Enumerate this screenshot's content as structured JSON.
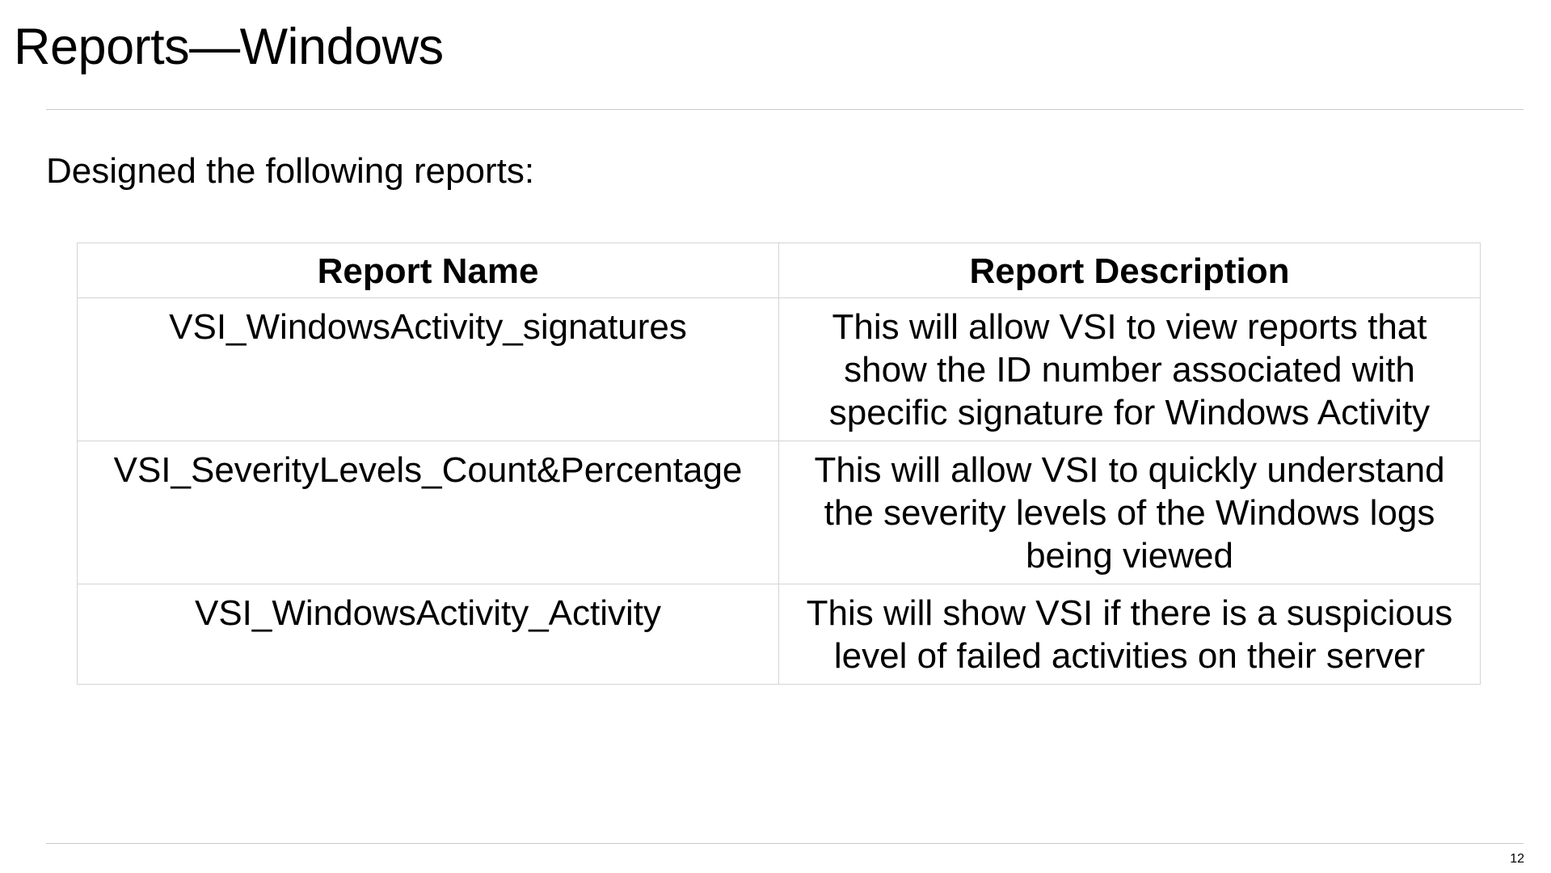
{
  "slide": {
    "title": "Reports—Windows",
    "intro": "Designed the following reports:",
    "page_number": "12"
  },
  "table": {
    "headers": [
      "Report Name",
      "Report Description"
    ],
    "rows": [
      {
        "name": "VSI_WindowsActivity_signatures",
        "description": "This will allow VSI to view reports that show the ID number associated with specific signature for Windows Activity"
      },
      {
        "name": "VSI_SeverityLevels_Count&Percentage",
        "description": "This will allow VSI to quickly understand the severity levels of the Windows logs being viewed"
      },
      {
        "name": "VSI_WindowsActivity_Activity",
        "description": "This will show VSI if there is a suspicious level of failed activities on their server"
      }
    ]
  }
}
